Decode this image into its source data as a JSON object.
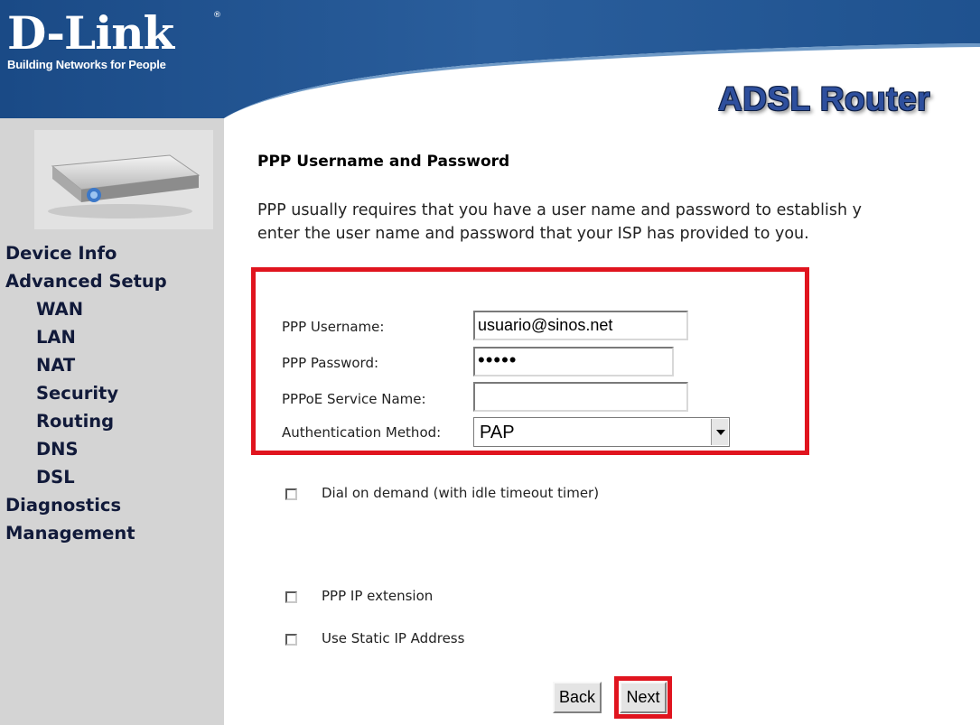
{
  "header": {
    "logo_text": "D-Link",
    "logo_registered": "®",
    "logo_tagline": "Building Networks for People",
    "product_name": "ADSL Router",
    "colors": {
      "banner": "#1d4f8a",
      "banner_light": "#3f78b2"
    }
  },
  "sidebar": {
    "device_image": "adsl-router-device-image",
    "items": [
      {
        "label": "Device Info",
        "level": 0
      },
      {
        "label": "Advanced Setup",
        "level": 0
      },
      {
        "label": "WAN",
        "level": 1
      },
      {
        "label": "LAN",
        "level": 1
      },
      {
        "label": "NAT",
        "level": 1
      },
      {
        "label": "Security",
        "level": 1
      },
      {
        "label": "Routing",
        "level": 1
      },
      {
        "label": "DNS",
        "level": 1
      },
      {
        "label": "DSL",
        "level": 1
      },
      {
        "label": "Diagnostics",
        "level": 0
      },
      {
        "label": "Management",
        "level": 0
      }
    ]
  },
  "main": {
    "title": "PPP Username and Password",
    "description_line1": "PPP usually requires that you have a user name and password to establish y",
    "description_line2": "enter the user name and password that your ISP has provided to you.",
    "form": {
      "username_label": "PPP Username:",
      "username_value": "usuario@sinos.net",
      "password_label": "PPP Password:",
      "password_value": "•••••",
      "service_label": "PPPoE Service Name:",
      "service_value": "",
      "auth_label": "Authentication Method:",
      "auth_value": "PAP"
    },
    "options": {
      "dial_on_demand": "Dial on demand (with idle timeout timer)",
      "ip_extension": "PPP IP extension",
      "static_ip": "Use Static IP Address"
    },
    "buttons": {
      "back": "Back",
      "next": "Next"
    },
    "highlight_color": "#e0141e"
  }
}
